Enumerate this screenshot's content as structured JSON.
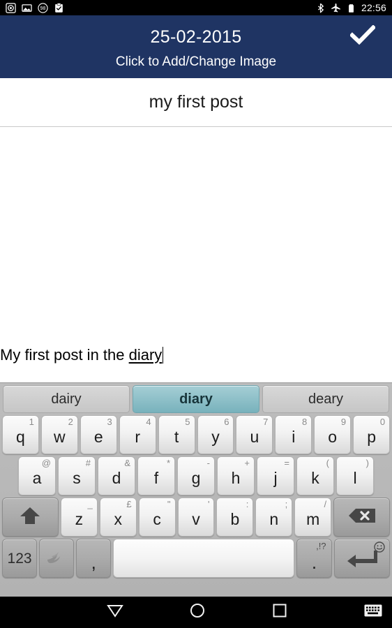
{
  "status_bar": {
    "left_icons": [
      {
        "name": "camera-aperture-icon",
        "label": "camera"
      },
      {
        "name": "image-icon",
        "label": "image"
      },
      {
        "name": "badge-98-icon",
        "label": "98"
      },
      {
        "name": "clipboard-check-icon",
        "label": "clipboard"
      }
    ],
    "right_icons": [
      {
        "name": "bluetooth-icon",
        "label": "bluetooth"
      },
      {
        "name": "airplane-mode-icon",
        "label": "airplane mode"
      },
      {
        "name": "battery-icon",
        "label": "battery"
      }
    ],
    "badge_count": "98",
    "time": "22:56"
  },
  "header": {
    "date_title": "25-02-2015",
    "subtitle": "Click to Add/Change Image",
    "confirm_icon": "check-icon",
    "background_color": "#1f3463"
  },
  "post": {
    "title": "my first post",
    "body_prefix": "My first post in the ",
    "body_composing_word": "diary"
  },
  "keyboard": {
    "suggestions": [
      {
        "text": "dairy",
        "selected": false
      },
      {
        "text": "diary",
        "selected": true
      },
      {
        "text": "deary",
        "selected": false
      }
    ],
    "selected_color": "#78b2bc",
    "row1": [
      {
        "key": "q",
        "hint": "1"
      },
      {
        "key": "w",
        "hint": "2"
      },
      {
        "key": "e",
        "hint": "3"
      },
      {
        "key": "r",
        "hint": "4"
      },
      {
        "key": "t",
        "hint": "5"
      },
      {
        "key": "y",
        "hint": "6"
      },
      {
        "key": "u",
        "hint": "7"
      },
      {
        "key": "i",
        "hint": "8"
      },
      {
        "key": "o",
        "hint": "9"
      },
      {
        "key": "p",
        "hint": "0"
      }
    ],
    "row2": [
      {
        "key": "a",
        "hint": "@"
      },
      {
        "key": "s",
        "hint": "#"
      },
      {
        "key": "d",
        "hint": "&"
      },
      {
        "key": "f",
        "hint": "*"
      },
      {
        "key": "g",
        "hint": "-"
      },
      {
        "key": "h",
        "hint": "+"
      },
      {
        "key": "j",
        "hint": "="
      },
      {
        "key": "k",
        "hint": "("
      },
      {
        "key": "l",
        "hint": ")"
      }
    ],
    "row3": [
      {
        "key": "z",
        "hint": "_"
      },
      {
        "key": "x",
        "hint": "£"
      },
      {
        "key": "c",
        "hint": "\""
      },
      {
        "key": "v",
        "hint": "'"
      },
      {
        "key": "b",
        "hint": ":"
      },
      {
        "key": "n",
        "hint": ";"
      },
      {
        "key": "m",
        "hint": "/"
      }
    ],
    "shift_icon": "shift-arrow-icon",
    "backspace_icon": "backspace-icon",
    "numeric_label": "123",
    "swiftkey_icon": "swiftkey-logo-icon",
    "comma_label": ",",
    "space_label": "",
    "period_label": ".",
    "period_hint": ",!?",
    "enter_icon": "enter-return-icon",
    "emoji_hint_icon": "smiley-icon"
  },
  "navbar": {
    "back_icon": "down-triangle-back-icon",
    "home_icon": "circle-home-icon",
    "recents_icon": "square-recents-icon",
    "keyboard_icon": "keyboard-icon"
  }
}
